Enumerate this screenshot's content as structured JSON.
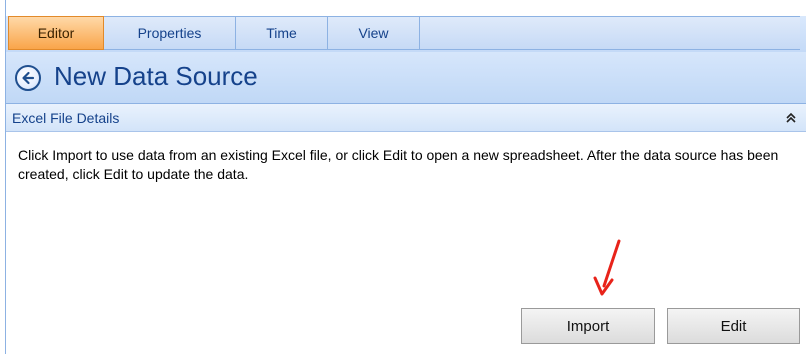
{
  "tabs": [
    {
      "label": "Editor",
      "active": true
    },
    {
      "label": "Properties",
      "active": false
    },
    {
      "label": "Time",
      "active": false
    },
    {
      "label": "View",
      "active": false
    }
  ],
  "header": {
    "back_icon": "back-arrow-icon",
    "title": "New Data Source"
  },
  "section": {
    "title": "Excel File Details",
    "collapse_icon": "double-chevron-up-icon"
  },
  "content": {
    "description": "Click Import to use data from an existing Excel file, or click Edit to open a new spreadsheet. After the data source has been created, click Edit to update the data."
  },
  "buttons": {
    "import_label": "Import",
    "edit_label": "Edit"
  },
  "annotation": {
    "icon": "red-arrow-icon",
    "color": "#e8231a"
  },
  "colors": {
    "active_tab": "#f9a54a",
    "header_text": "#15428b",
    "border": "#8db2e3"
  }
}
